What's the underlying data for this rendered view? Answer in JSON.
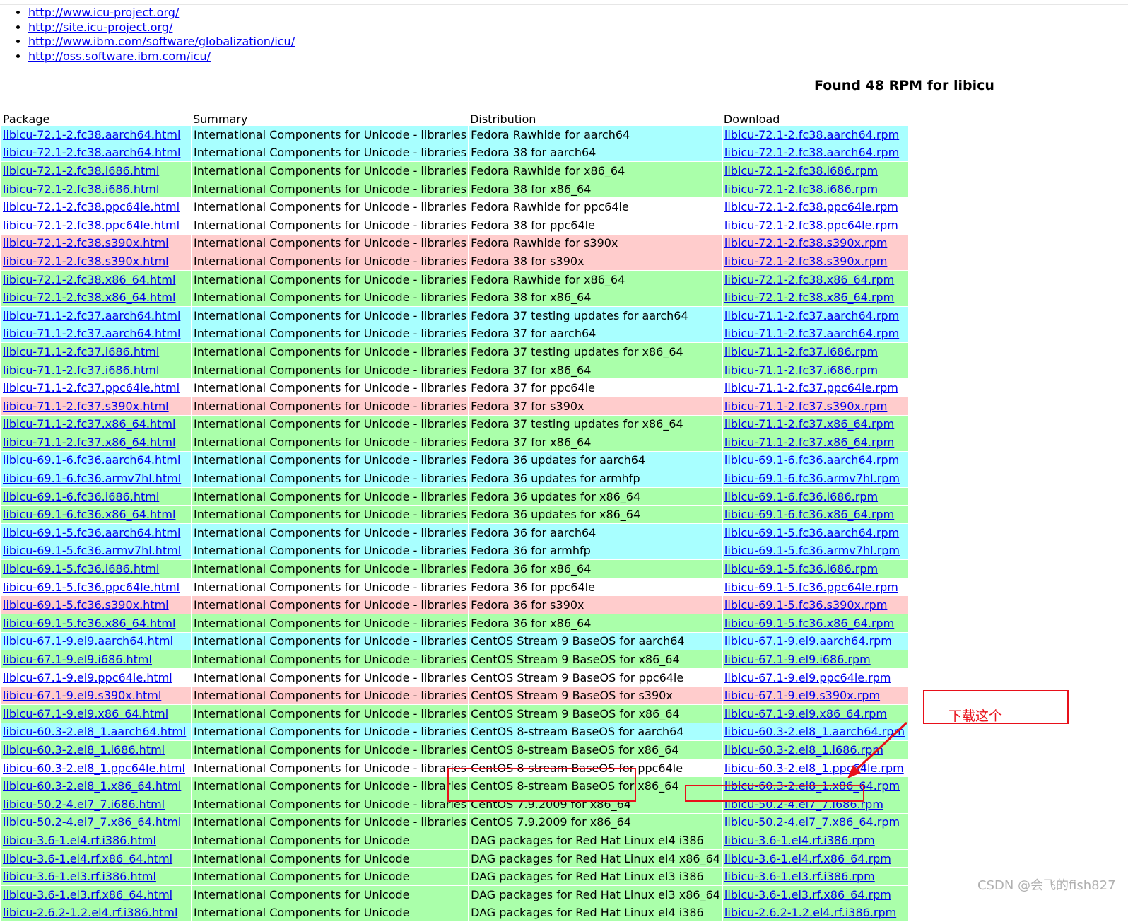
{
  "links": [
    "http://www.icu-project.org/",
    "http://site.icu-project.org/",
    "http://www.ibm.com/software/globalization/icu/",
    "http://oss.software.ibm.com/icu/"
  ],
  "found_title": "Found 48 RPM for libicu",
  "headers": [
    "Package",
    "Summary",
    "Distribution",
    "Download"
  ],
  "colors": {
    "cyan": "#a8ffff",
    "green": "#aaffaa",
    "pink": "#ffcccc",
    "white": "#ffffff",
    "annotation": "#e8101a"
  },
  "rows": [
    {
      "pkg": "libicu-72.1-2.fc38.aarch64.html",
      "summary": "International Components for Unicode - libraries",
      "dist": "Fedora Rawhide for aarch64",
      "dl": "libicu-72.1-2.fc38.aarch64.rpm",
      "bg": "cyan"
    },
    {
      "pkg": "libicu-72.1-2.fc38.aarch64.html",
      "summary": "International Components for Unicode - libraries",
      "dist": "Fedora 38 for aarch64",
      "dl": "libicu-72.1-2.fc38.aarch64.rpm",
      "bg": "cyan"
    },
    {
      "pkg": "libicu-72.1-2.fc38.i686.html",
      "summary": "International Components for Unicode - libraries",
      "dist": "Fedora Rawhide for x86_64",
      "dl": "libicu-72.1-2.fc38.i686.rpm",
      "bg": "green"
    },
    {
      "pkg": "libicu-72.1-2.fc38.i686.html",
      "summary": "International Components for Unicode - libraries",
      "dist": "Fedora 38 for x86_64",
      "dl": "libicu-72.1-2.fc38.i686.rpm",
      "bg": "green"
    },
    {
      "pkg": "libicu-72.1-2.fc38.ppc64le.html",
      "summary": "International Components for Unicode - libraries",
      "dist": "Fedora Rawhide for ppc64le",
      "dl": "libicu-72.1-2.fc38.ppc64le.rpm",
      "bg": "white"
    },
    {
      "pkg": "libicu-72.1-2.fc38.ppc64le.html",
      "summary": "International Components for Unicode - libraries",
      "dist": "Fedora 38 for ppc64le",
      "dl": "libicu-72.1-2.fc38.ppc64le.rpm",
      "bg": "white"
    },
    {
      "pkg": "libicu-72.1-2.fc38.s390x.html",
      "summary": "International Components for Unicode - libraries",
      "dist": "Fedora Rawhide for s390x",
      "dl": "libicu-72.1-2.fc38.s390x.rpm",
      "bg": "pink"
    },
    {
      "pkg": "libicu-72.1-2.fc38.s390x.html",
      "summary": "International Components for Unicode - libraries",
      "dist": "Fedora 38 for s390x",
      "dl": "libicu-72.1-2.fc38.s390x.rpm",
      "bg": "pink"
    },
    {
      "pkg": "libicu-72.1-2.fc38.x86_64.html",
      "summary": "International Components for Unicode - libraries",
      "dist": "Fedora Rawhide for x86_64",
      "dl": "libicu-72.1-2.fc38.x86_64.rpm",
      "bg": "green"
    },
    {
      "pkg": "libicu-72.1-2.fc38.x86_64.html",
      "summary": "International Components for Unicode - libraries",
      "dist": "Fedora 38 for x86_64",
      "dl": "libicu-72.1-2.fc38.x86_64.rpm",
      "bg": "green"
    },
    {
      "pkg": "libicu-71.1-2.fc37.aarch64.html",
      "summary": "International Components for Unicode - libraries",
      "dist": "Fedora 37 testing updates for aarch64",
      "dl": "libicu-71.1-2.fc37.aarch64.rpm",
      "bg": "cyan"
    },
    {
      "pkg": "libicu-71.1-2.fc37.aarch64.html",
      "summary": "International Components for Unicode - libraries",
      "dist": "Fedora 37 for aarch64",
      "dl": "libicu-71.1-2.fc37.aarch64.rpm",
      "bg": "cyan"
    },
    {
      "pkg": "libicu-71.1-2.fc37.i686.html",
      "summary": "International Components for Unicode - libraries",
      "dist": "Fedora 37 testing updates for x86_64",
      "dl": "libicu-71.1-2.fc37.i686.rpm",
      "bg": "green"
    },
    {
      "pkg": "libicu-71.1-2.fc37.i686.html",
      "summary": "International Components for Unicode - libraries",
      "dist": "Fedora 37 for x86_64",
      "dl": "libicu-71.1-2.fc37.i686.rpm",
      "bg": "green"
    },
    {
      "pkg": "libicu-71.1-2.fc37.ppc64le.html",
      "summary": "International Components for Unicode - libraries",
      "dist": "Fedora 37 for ppc64le",
      "dl": "libicu-71.1-2.fc37.ppc64le.rpm",
      "bg": "white"
    },
    {
      "pkg": "libicu-71.1-2.fc37.s390x.html",
      "summary": "International Components for Unicode - libraries",
      "dist": "Fedora 37 for s390x",
      "dl": "libicu-71.1-2.fc37.s390x.rpm",
      "bg": "pink"
    },
    {
      "pkg": "libicu-71.1-2.fc37.x86_64.html",
      "summary": "International Components for Unicode - libraries",
      "dist": "Fedora 37 testing updates for x86_64",
      "dl": "libicu-71.1-2.fc37.x86_64.rpm",
      "bg": "green"
    },
    {
      "pkg": "libicu-71.1-2.fc37.x86_64.html",
      "summary": "International Components for Unicode - libraries",
      "dist": "Fedora 37 for x86_64",
      "dl": "libicu-71.1-2.fc37.x86_64.rpm",
      "bg": "green"
    },
    {
      "pkg": "libicu-69.1-6.fc36.aarch64.html",
      "summary": "International Components for Unicode - libraries",
      "dist": "Fedora 36 updates for aarch64",
      "dl": "libicu-69.1-6.fc36.aarch64.rpm",
      "bg": "cyan"
    },
    {
      "pkg": "libicu-69.1-6.fc36.armv7hl.html",
      "summary": "International Components for Unicode - libraries",
      "dist": "Fedora 36 updates for armhfp",
      "dl": "libicu-69.1-6.fc36.armv7hl.rpm",
      "bg": "cyan"
    },
    {
      "pkg": "libicu-69.1-6.fc36.i686.html",
      "summary": "International Components for Unicode - libraries",
      "dist": "Fedora 36 updates for x86_64",
      "dl": "libicu-69.1-6.fc36.i686.rpm",
      "bg": "green"
    },
    {
      "pkg": "libicu-69.1-6.fc36.x86_64.html",
      "summary": "International Components for Unicode - libraries",
      "dist": "Fedora 36 updates for x86_64",
      "dl": "libicu-69.1-6.fc36.x86_64.rpm",
      "bg": "green"
    },
    {
      "pkg": "libicu-69.1-5.fc36.aarch64.html",
      "summary": "International Components for Unicode - libraries",
      "dist": "Fedora 36 for aarch64",
      "dl": "libicu-69.1-5.fc36.aarch64.rpm",
      "bg": "cyan"
    },
    {
      "pkg": "libicu-69.1-5.fc36.armv7hl.html",
      "summary": "International Components for Unicode - libraries",
      "dist": "Fedora 36 for armhfp",
      "dl": "libicu-69.1-5.fc36.armv7hl.rpm",
      "bg": "cyan"
    },
    {
      "pkg": "libicu-69.1-5.fc36.i686.html",
      "summary": "International Components for Unicode - libraries",
      "dist": "Fedora 36 for x86_64",
      "dl": "libicu-69.1-5.fc36.i686.rpm",
      "bg": "green"
    },
    {
      "pkg": "libicu-69.1-5.fc36.ppc64le.html",
      "summary": "International Components for Unicode - libraries",
      "dist": "Fedora 36 for ppc64le",
      "dl": "libicu-69.1-5.fc36.ppc64le.rpm",
      "bg": "white"
    },
    {
      "pkg": "libicu-69.1-5.fc36.s390x.html",
      "summary": "International Components for Unicode - libraries",
      "dist": "Fedora 36 for s390x",
      "dl": "libicu-69.1-5.fc36.s390x.rpm",
      "bg": "pink"
    },
    {
      "pkg": "libicu-69.1-5.fc36.x86_64.html",
      "summary": "International Components for Unicode - libraries",
      "dist": "Fedora 36 for x86_64",
      "dl": "libicu-69.1-5.fc36.x86_64.rpm",
      "bg": "green"
    },
    {
      "pkg": "libicu-67.1-9.el9.aarch64.html",
      "summary": "International Components for Unicode - libraries",
      "dist": "CentOS Stream 9 BaseOS for aarch64",
      "dl": "libicu-67.1-9.el9.aarch64.rpm",
      "bg": "cyan"
    },
    {
      "pkg": "libicu-67.1-9.el9.i686.html",
      "summary": "International Components for Unicode - libraries",
      "dist": "CentOS Stream 9 BaseOS for x86_64",
      "dl": "libicu-67.1-9.el9.i686.rpm",
      "bg": "green"
    },
    {
      "pkg": "libicu-67.1-9.el9.ppc64le.html",
      "summary": "International Components for Unicode - libraries",
      "dist": "CentOS Stream 9 BaseOS for ppc64le",
      "dl": "libicu-67.1-9.el9.ppc64le.rpm",
      "bg": "white"
    },
    {
      "pkg": "libicu-67.1-9.el9.s390x.html",
      "summary": "International Components for Unicode - libraries",
      "dist": "CentOS Stream 9 BaseOS for s390x",
      "dl": "libicu-67.1-9.el9.s390x.rpm",
      "bg": "pink"
    },
    {
      "pkg": "libicu-67.1-9.el9.x86_64.html",
      "summary": "International Components for Unicode - libraries",
      "dist": "CentOS Stream 9 BaseOS for x86_64",
      "dl": "libicu-67.1-9.el9.x86_64.rpm",
      "bg": "green"
    },
    {
      "pkg": "libicu-60.3-2.el8_1.aarch64.html",
      "summary": "International Components for Unicode - libraries",
      "dist": "CentOS 8-stream BaseOS for aarch64",
      "dl": "libicu-60.3-2.el8_1.aarch64.rpm",
      "bg": "cyan"
    },
    {
      "pkg": "libicu-60.3-2.el8_1.i686.html",
      "summary": "International Components for Unicode - libraries",
      "dist": "CentOS 8-stream BaseOS for x86_64",
      "dl": "libicu-60.3-2.el8_1.i686.rpm",
      "bg": "green"
    },
    {
      "pkg": "libicu-60.3-2.el8_1.ppc64le.html",
      "summary": "International Components for Unicode - libraries",
      "dist": "CentOS 8-stream BaseOS for ppc64le",
      "dl": "libicu-60.3-2.el8_1.ppc64le.rpm",
      "bg": "white"
    },
    {
      "pkg": "libicu-60.3-2.el8_1.x86_64.html",
      "summary": "International Components for Unicode - libraries",
      "dist": "CentOS 8-stream BaseOS for x86_64",
      "dl": "libicu-60.3-2.el8_1.x86_64.rpm",
      "bg": "green"
    },
    {
      "pkg": "libicu-50.2-4.el7_7.i686.html",
      "summary": "International Components for Unicode - libraries",
      "dist": "CentOS 7.9.2009 for x86_64",
      "dl": "libicu-50.2-4.el7_7.i686.rpm",
      "bg": "green"
    },
    {
      "pkg": "libicu-50.2-4.el7_7.x86_64.html",
      "summary": "International Components for Unicode - libraries",
      "dist": "CentOS 7.9.2009 for x86_64",
      "dl": "libicu-50.2-4.el7_7.x86_64.rpm",
      "bg": "green"
    },
    {
      "pkg": "libicu-3.6-1.el4.rf.i386.html",
      "summary": "International Components for Unicode",
      "dist": "DAG packages for Red Hat Linux el4 i386",
      "dl": "libicu-3.6-1.el4.rf.i386.rpm",
      "bg": "green"
    },
    {
      "pkg": "libicu-3.6-1.el4.rf.x86_64.html",
      "summary": "International Components for Unicode",
      "dist": "DAG packages for Red Hat Linux el4 x86_64",
      "dl": "libicu-3.6-1.el4.rf.x86_64.rpm",
      "bg": "green"
    },
    {
      "pkg": "libicu-3.6-1.el3.rf.i386.html",
      "summary": "International Components for Unicode",
      "dist": "DAG packages for Red Hat Linux el3 i386",
      "dl": "libicu-3.6-1.el3.rf.i386.rpm",
      "bg": "green"
    },
    {
      "pkg": "libicu-3.6-1.el3.rf.x86_64.html",
      "summary": "International Components for Unicode",
      "dist": "DAG packages for Red Hat Linux el3 x86_64",
      "dl": "libicu-3.6-1.el3.rf.x86_64.rpm",
      "bg": "green"
    },
    {
      "pkg": "libicu-2.6.2-1.2.el4.rf.i386.html",
      "summary": "International Components for Unicode",
      "dist": "DAG packages for Red Hat Linux el4 i386",
      "dl": "libicu-2.6.2-1.2.el4.rf.i386.rpm",
      "bg": "green"
    }
  ],
  "annotation": {
    "label": "下载这个"
  },
  "watermark": "CSDN @会飞的fish827"
}
